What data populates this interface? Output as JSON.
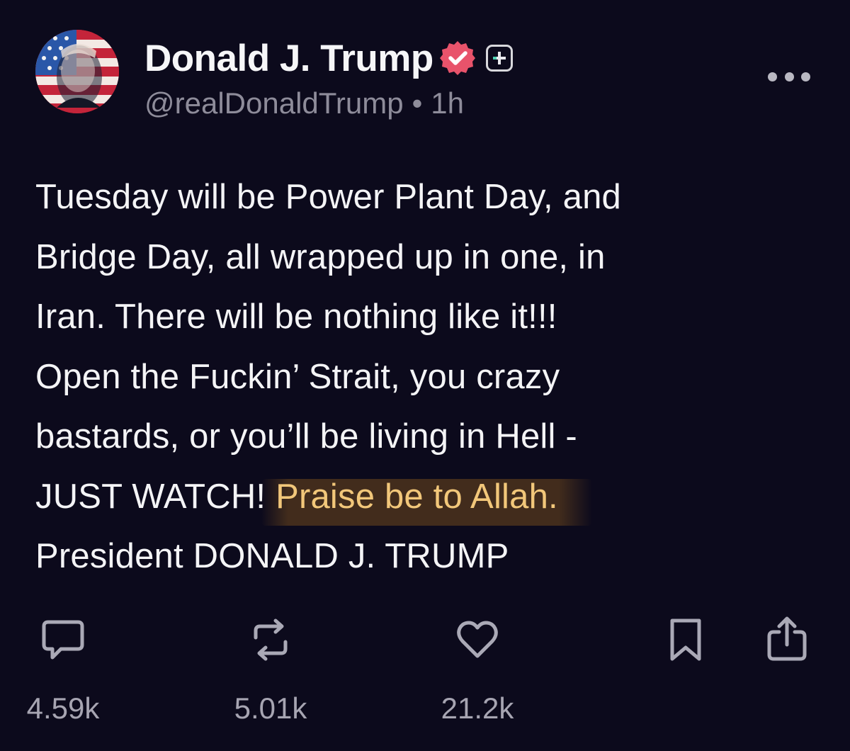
{
  "post": {
    "author": {
      "display_name": "Donald J. Trump",
      "handle": "@realDonaldTrump",
      "separator": "•",
      "time": "1h",
      "avatar_icon": "avatar-image",
      "verified_icon": "verified-badge-icon",
      "subscribe_icon": "plus-badge-icon"
    },
    "more_icon": "more-options-icon",
    "body_lines": [
      "Tuesday will be Power Plant Day, and",
      "Bridge Day, all wrapped up in one, in",
      "Iran. There will be nothing like it!!!",
      "Open the Fuckin’ Strait, you crazy",
      "bastards, or you’ll be living in Hell -",
      "JUST WATCH!",
      "Praise be to Allah.",
      "President DONALD J. TRUMP"
    ],
    "actions": {
      "reply": {
        "icon": "reply-icon",
        "count": "4.59k"
      },
      "repost": {
        "icon": "repost-icon",
        "count": "5.01k"
      },
      "like": {
        "icon": "heart-icon",
        "count": "21.2k"
      },
      "bookmark": {
        "icon": "bookmark-icon"
      },
      "share": {
        "icon": "share-icon"
      }
    },
    "colors": {
      "background": "#0c0a1c",
      "text": "#f4f4f6",
      "secondary_text": "#8e8c9a",
      "highlight_text": "#f2c77a",
      "verified_badge": "#e8536b"
    }
  }
}
